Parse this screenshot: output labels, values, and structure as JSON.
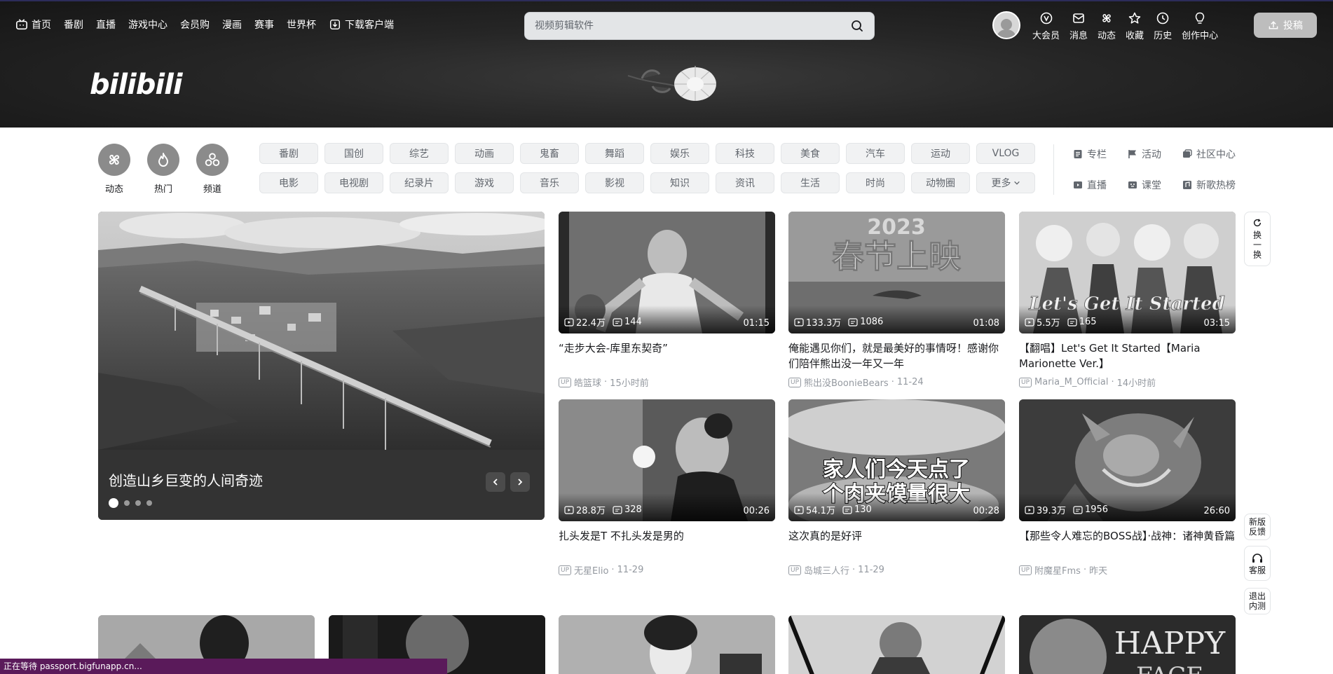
{
  "header": {
    "nav_left": [
      {
        "label": "首页",
        "icon": "tv-icon"
      },
      {
        "label": "番剧"
      },
      {
        "label": "直播"
      },
      {
        "label": "游戏中心"
      },
      {
        "label": "会员购"
      },
      {
        "label": "漫画"
      },
      {
        "label": "赛事"
      },
      {
        "label": "世界杯"
      },
      {
        "label": "下载客户端",
        "icon": "download-icon"
      }
    ],
    "search": {
      "placeholder": "视频剪辑软件"
    },
    "nav_right": [
      "大会员",
      "消息",
      "动态",
      "收藏",
      "历史",
      "创作中心"
    ],
    "upload_label": "投稿",
    "logo": "bilibili"
  },
  "channels": {
    "circles": [
      "动态",
      "热门",
      "频道"
    ],
    "tags": [
      "番剧",
      "国创",
      "综艺",
      "动画",
      "鬼畜",
      "舞蹈",
      "娱乐",
      "科技",
      "美食",
      "汽车",
      "运动",
      "VLOG",
      "电影",
      "电视剧",
      "纪录片",
      "游戏",
      "音乐",
      "影视",
      "知识",
      "资讯",
      "生活",
      "时尚",
      "动物圈",
      "更多"
    ],
    "links": [
      "专栏",
      "活动",
      "社区中心",
      "直播",
      "课堂",
      "新歌热榜"
    ]
  },
  "carousel": {
    "title": "创造山乡巨变的人间奇迹",
    "slide_count": 4,
    "active_index": 0
  },
  "videos": [
    {
      "views": "22.4万",
      "danmaku": "144",
      "duration": "01:15",
      "title": "“走步大会-库里东契奇”",
      "uploader": "皓篮球",
      "date": "15小时前"
    },
    {
      "views": "133.3万",
      "danmaku": "1086",
      "duration": "01:08",
      "title": "俺能遇见你们，就是最美好的事情呀！感谢你们陪伴熊出没一年又一年",
      "uploader": "熊出没BoonieBears",
      "date": "11-24"
    },
    {
      "views": "5.5万",
      "danmaku": "165",
      "duration": "03:15",
      "title": "【翻唱】Let's Get It Started【Maria Marionette Ver.】",
      "uploader": "Maria_M_Official",
      "date": "14小时前"
    },
    {
      "views": "28.8万",
      "danmaku": "328",
      "duration": "00:26",
      "title": "扎头发是T 不扎头发是男的",
      "uploader": "无星Elio",
      "date": "11-29"
    },
    {
      "views": "54.1万",
      "danmaku": "130",
      "duration": "00:28",
      "title": "这次真的是好评",
      "uploader": "岛城三人行",
      "date": "11-29"
    },
    {
      "views": "39.3万",
      "danmaku": "1956",
      "duration": "26:60",
      "title": "【那些令人难忘的BOSS战】·战神：诸神黄昏篇",
      "uploader": "附魔星Fms",
      "date": "昨天"
    }
  ],
  "thumb_text": {
    "v2_year": "2023",
    "v2_caption": "春节上映",
    "v3_caption": "Let's Get It Started",
    "v5_line1": "家人们今天点了",
    "v5_line2": "个肉夹馍量很大",
    "b5_caption": "HAPPY",
    "b5_caption2": "FACE"
  },
  "sidebar": {
    "refresh_label": "换一换",
    "feedback_label": "新版反馈",
    "service_label": "客服",
    "exit_label": "退出内测"
  },
  "status_bar": "正在等待 passport.bigfunapp.cn..."
}
